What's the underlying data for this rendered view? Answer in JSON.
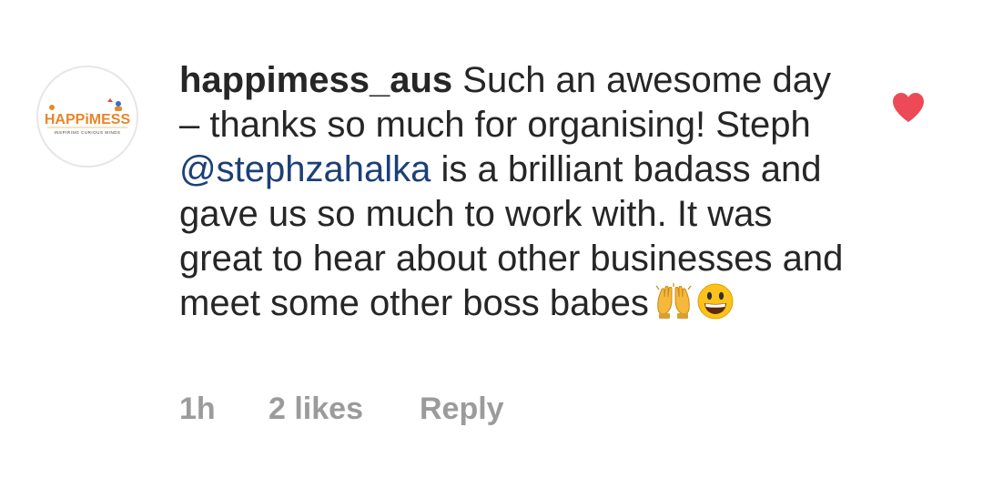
{
  "avatar": {
    "brand_text": "HAPPiMESS",
    "tagline": "INSPIRING CURIOUS MINDS",
    "icon": "happimess-logo"
  },
  "comment": {
    "username": "happimess_aus",
    "text_part1": "Such an awesome day – thanks so much for organising! Steph",
    "mention": "@stephzahalka",
    "text_part2": "is a brilliant badass and gave us so much to work with. It was great to hear about other businesses and meet some other boss babes",
    "emojis": [
      "raising-hands-emoji",
      "grinning-face-emoji"
    ]
  },
  "like_icon": {
    "name": "heart-icon",
    "liked": true,
    "color": "#ed4956"
  },
  "meta": {
    "time": "1h",
    "likes": "2 likes",
    "reply": "Reply"
  },
  "colors": {
    "text": "#262626",
    "mention": "#1c3f77",
    "meta": "#9b9b9b",
    "heart": "#ed4956"
  }
}
